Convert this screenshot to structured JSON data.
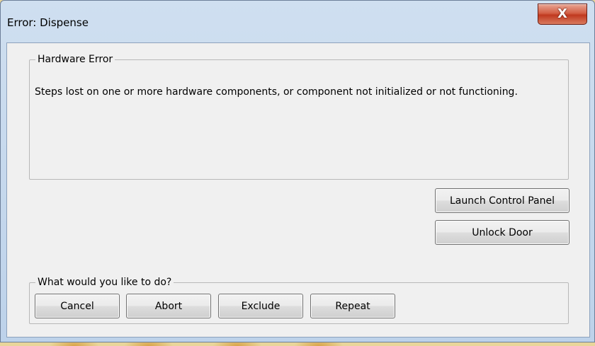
{
  "window": {
    "title": "Error: Dispense",
    "close_glyph": "X"
  },
  "error_group": {
    "legend": "Hardware Error",
    "message": "Steps lost on one or more hardware components, or component not initialized or not functioning."
  },
  "side_buttons": {
    "launch_control_panel": "Launch Control Panel",
    "unlock_door": "Unlock Door"
  },
  "choice_group": {
    "legend": "What would you like to do?",
    "buttons": [
      "Cancel",
      "Abort",
      "Exclude",
      "Repeat"
    ]
  },
  "colors": {
    "close_button": "#c8462b",
    "window_frame": "#bdd2ea",
    "client_background": "#f0f0f0"
  },
  "icons": {
    "close": "close-icon"
  }
}
